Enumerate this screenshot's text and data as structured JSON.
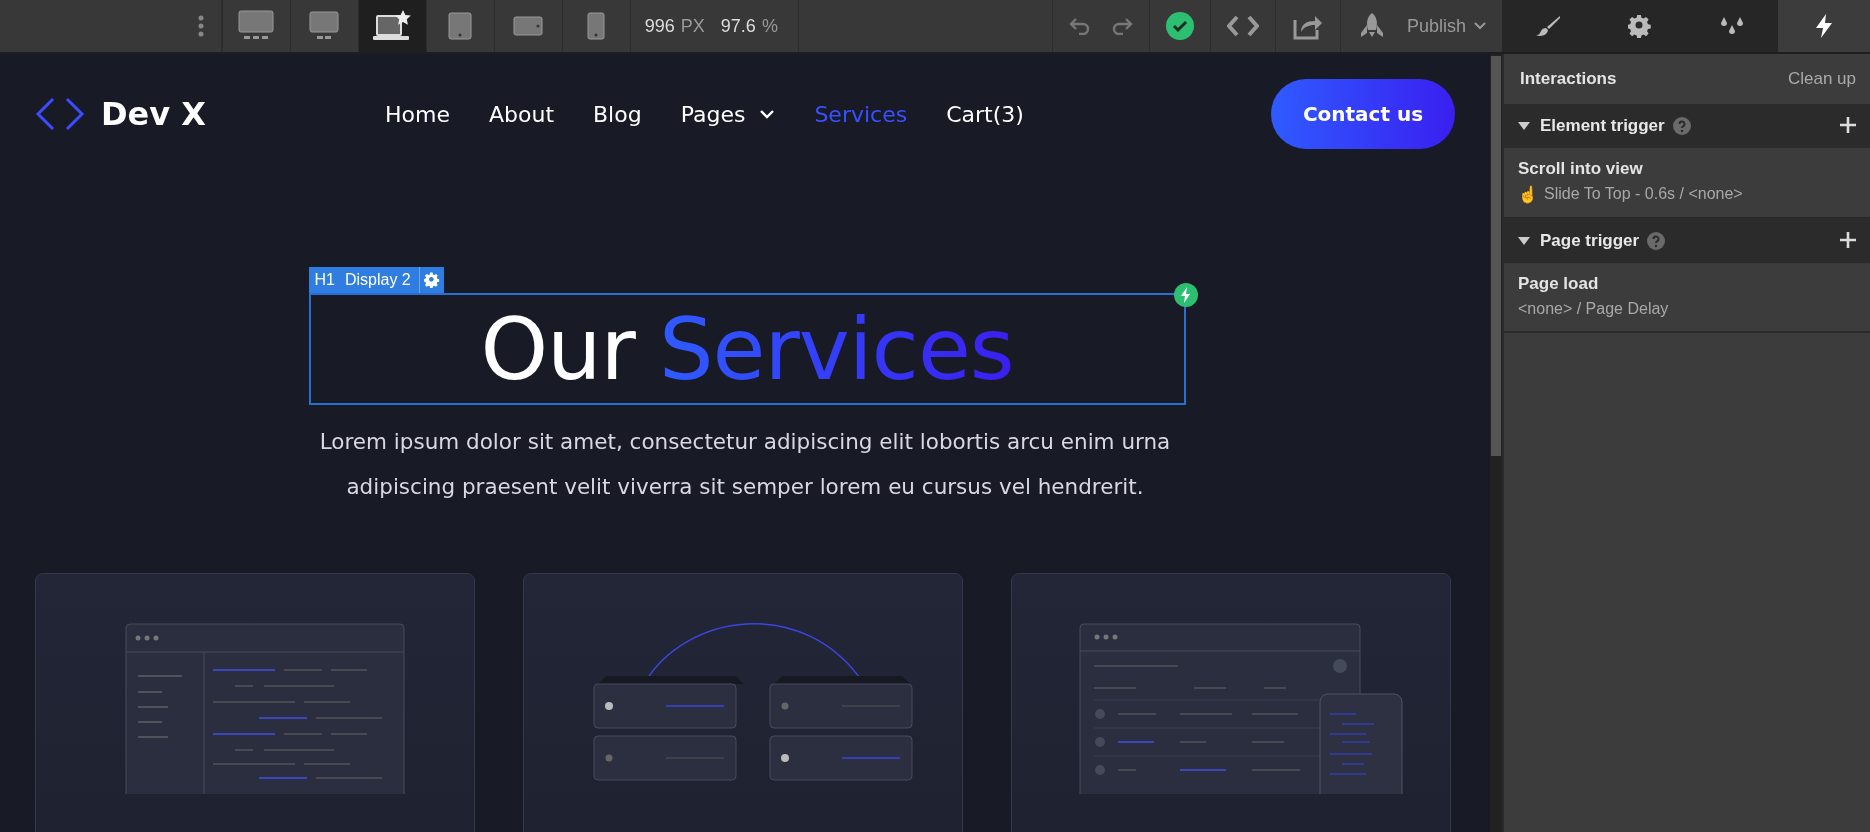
{
  "toolbar": {
    "breakpoints": [
      {
        "kind": "desktop-large",
        "selected": false
      },
      {
        "kind": "desktop",
        "selected": false
      },
      {
        "kind": "laptop-base",
        "selected": true
      },
      {
        "kind": "tablet",
        "selected": false
      },
      {
        "kind": "landscape",
        "selected": false
      },
      {
        "kind": "phone",
        "selected": false
      }
    ],
    "width_value": "996",
    "width_unit": "PX",
    "zoom_value": "97.6",
    "zoom_unit": "%",
    "publish_label": "Publish",
    "panel_tabs": [
      {
        "kind": "style",
        "selected": false
      },
      {
        "kind": "settings",
        "selected": false
      },
      {
        "kind": "swatches",
        "selected": false
      },
      {
        "kind": "interactions",
        "selected": true
      }
    ]
  },
  "site": {
    "brand": "Dev X",
    "nav_links": [
      {
        "label": "Home",
        "kind": "link",
        "selected": false
      },
      {
        "label": "About",
        "kind": "link",
        "selected": false
      },
      {
        "label": "Blog",
        "kind": "link",
        "selected": false
      },
      {
        "label": "Pages",
        "kind": "dropdown",
        "selected": false
      },
      {
        "label": "Services",
        "kind": "link",
        "selected": true
      },
      {
        "label": "Cart(3)",
        "kind": "link",
        "selected": false
      }
    ],
    "contact_button": "Contact us",
    "selection": {
      "tag": "H1",
      "class_name": "Display 2"
    },
    "heading": {
      "plain": "Our",
      "accent": "Services"
    },
    "intro": "Lorem ipsum dolor sit amet, consectetur adipiscing elit lobortis arcu enim urna adipiscing praesent velit viverra sit semper lorem eu cursus vel hendrerit.",
    "cards": [
      {
        "kind": "code-window"
      },
      {
        "kind": "servers"
      },
      {
        "kind": "dashboard"
      }
    ]
  },
  "panel": {
    "title": "Interactions",
    "action": "Clean up",
    "sections": [
      {
        "title": "Element trigger",
        "expanded": true,
        "items": [
          {
            "title": "Scroll into view",
            "pointer": "☝",
            "detail": "Slide To Top - 0.6s / <none>"
          }
        ]
      },
      {
        "title": "Page trigger",
        "expanded": true,
        "items": [
          {
            "title": "Page load",
            "detail": "<none> / Page Delay"
          }
        ]
      }
    ]
  }
}
